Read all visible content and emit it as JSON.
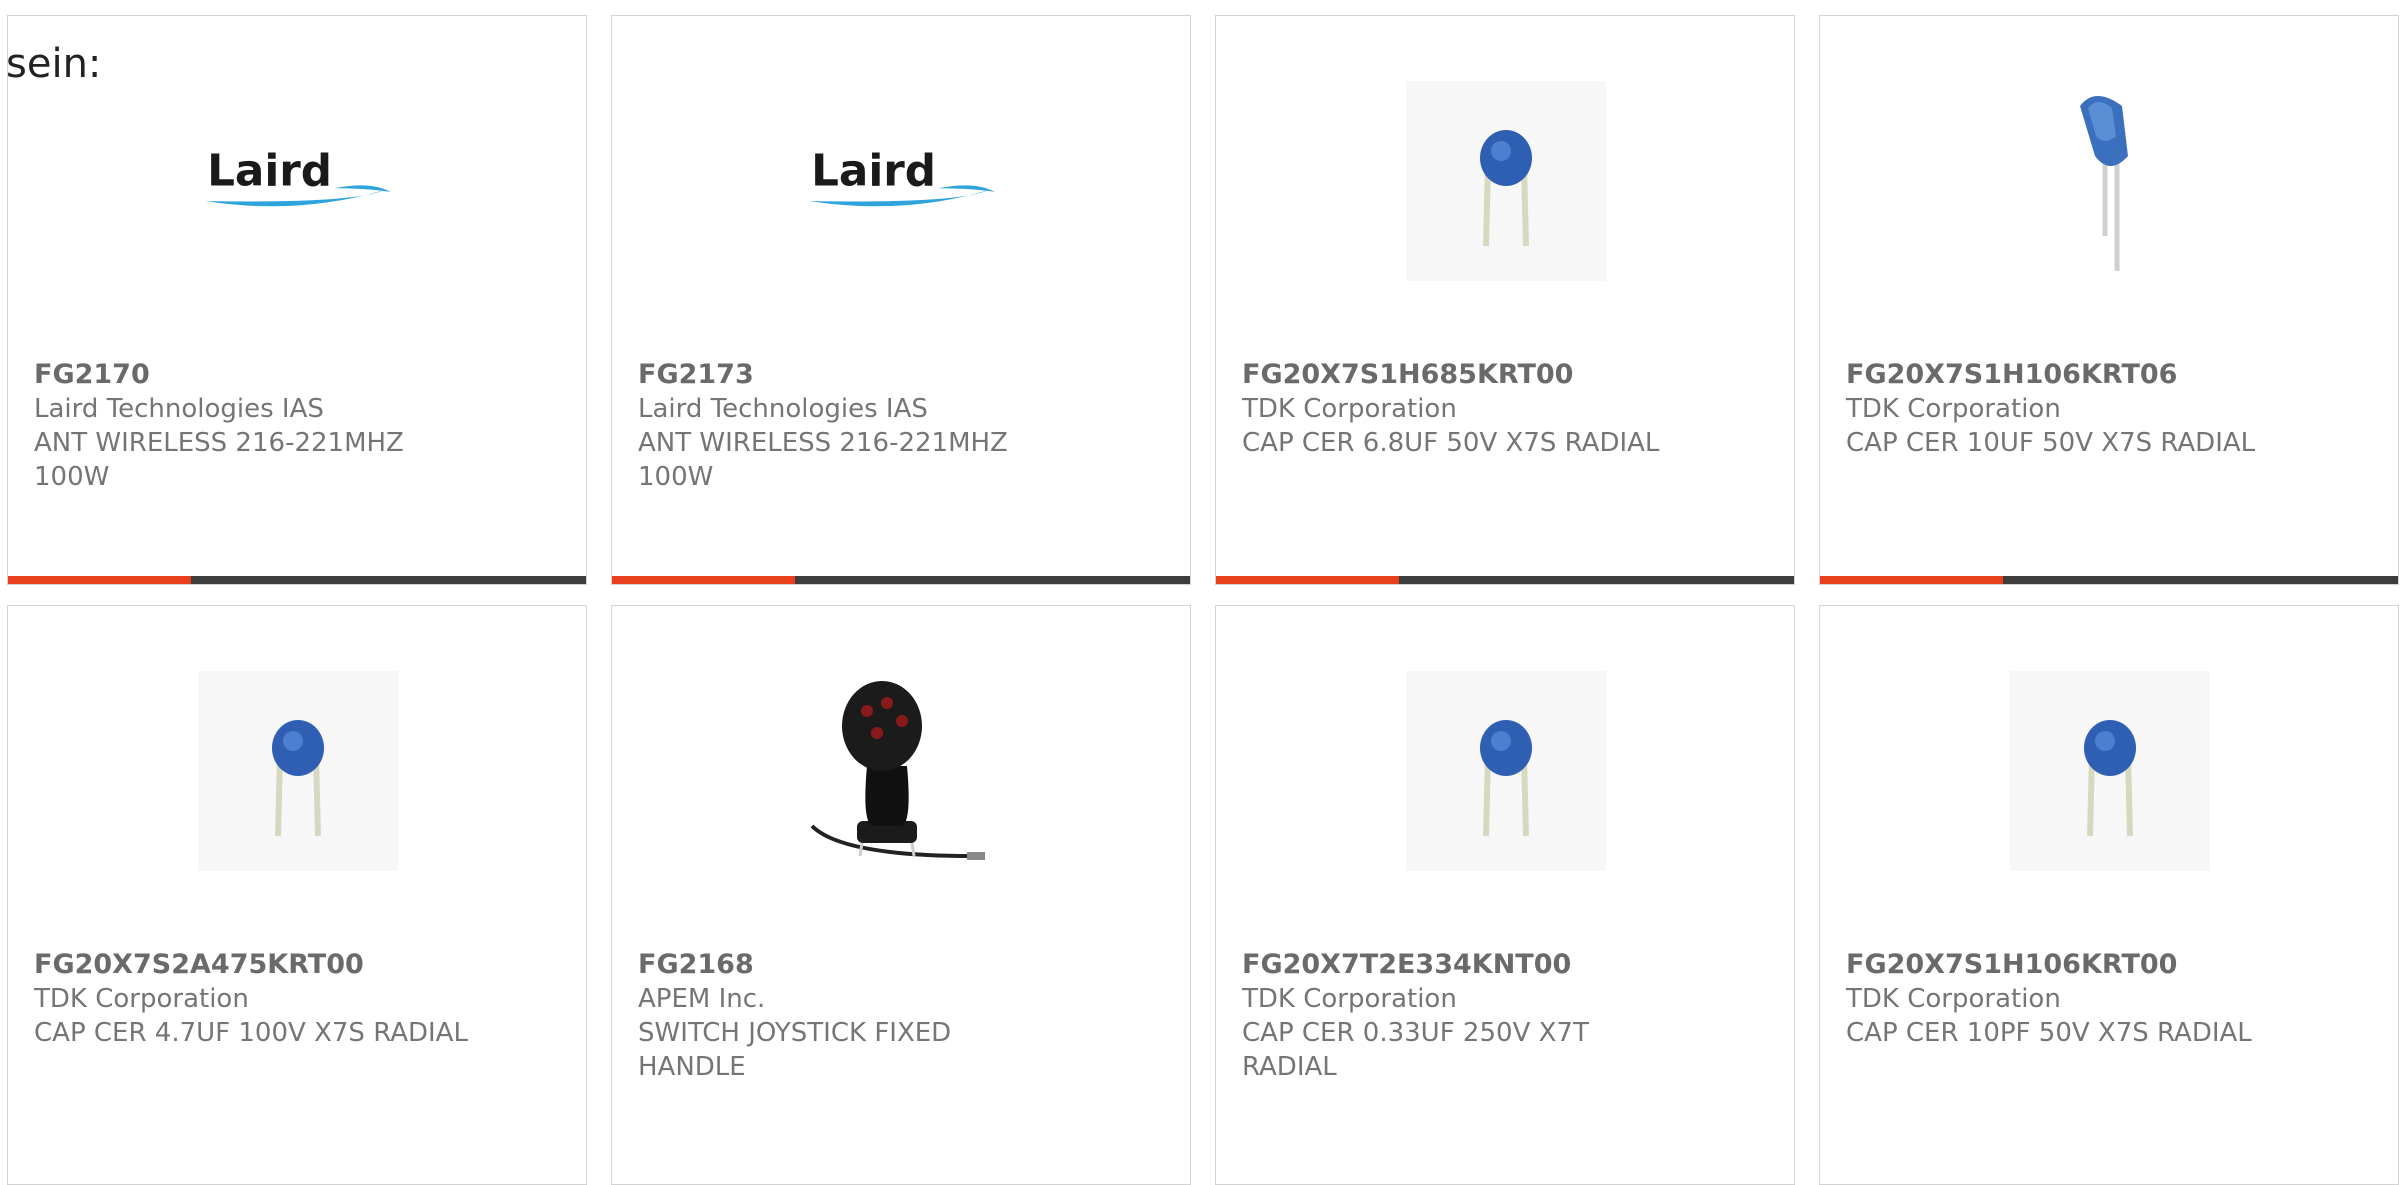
{
  "lead_text": "sein:",
  "colors": {
    "accent": "#e8401c",
    "bar_track": "#3d3d3d",
    "border": "#d3d3d3"
  },
  "products": [
    {
      "part_number": "FG2170",
      "manufacturer": "Laird Technologies IAS",
      "description": "ANT WIRELESS 216-221MHZ 100W",
      "image": "laird-logo",
      "logo_text": "Laird"
    },
    {
      "part_number": "FG2173",
      "manufacturer": "Laird Technologies IAS",
      "description": "ANT WIRELESS 216-221MHZ 100W",
      "image": "laird-logo",
      "logo_text": "Laird"
    },
    {
      "part_number": "FG20X7S1H685KRT00",
      "manufacturer": "TDK Corporation",
      "description": "CAP CER 6.8UF 50V X7S RADIAL",
      "image": "ceramic-capacitor"
    },
    {
      "part_number": "FG20X7S1H106KRT06",
      "manufacturer": "TDK Corporation",
      "description": "CAP CER 10UF 50V X7S RADIAL",
      "image": "ceramic-capacitor-tilted"
    },
    {
      "part_number": "FG20X7S2A475KRT00",
      "manufacturer": "TDK Corporation",
      "description": "CAP CER 4.7UF 100V X7S RADIAL",
      "image": "ceramic-capacitor"
    },
    {
      "part_number": "FG2168",
      "manufacturer": "APEM Inc.",
      "description": "SWITCH JOYSTICK FIXED HANDLE",
      "image": "joystick"
    },
    {
      "part_number": "FG20X7T2E334KNT00",
      "manufacturer": "TDK Corporation",
      "description": "CAP CER 0.33UF 250V X7T RADIAL",
      "image": "ceramic-capacitor"
    },
    {
      "part_number": "FG20X7S1H106KRT00",
      "manufacturer": "TDK Corporation",
      "description": "CAP CER 10PF 50V X7S RADIAL",
      "image": "ceramic-capacitor"
    }
  ]
}
